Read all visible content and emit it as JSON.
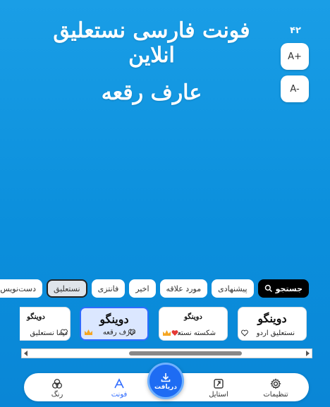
{
  "preview": {
    "line1": "فونت فارسی نستعلیق انلاین",
    "line2": "عارف رقعه"
  },
  "size_control": {
    "value": "۴۲",
    "increase_label": "A+",
    "decrease_label": "A-"
  },
  "categories": [
    {
      "label": "جستجو",
      "type": "search",
      "icon": "search-icon"
    },
    {
      "label": "پیشنهادی"
    },
    {
      "label": "مورد علاقه"
    },
    {
      "label": "اخیر"
    },
    {
      "label": "فانتزی"
    },
    {
      "label": "نستعلیق",
      "selected": true
    },
    {
      "label": "دست‌نویس"
    }
  ],
  "fonts": [
    {
      "sample": "دوینگو",
      "label": "نستعلیق اردو",
      "favorite": false,
      "premium": false
    },
    {
      "sample": "دوینگو",
      "label": "شکسته نستعلیق",
      "favorite": true,
      "premium": true
    },
    {
      "sample": "دوینگو",
      "label": "عارف رقعه",
      "favorite": false,
      "premium": true,
      "selected": true
    },
    {
      "sample": "دوینگو",
      "label": "دیما نستعلیق",
      "favorite": false,
      "premium": false
    }
  ],
  "nav": {
    "settings": "تنظیمات",
    "style": "استایل",
    "download": "دریافت",
    "font": "فونت",
    "color": "رنگ"
  },
  "colors": {
    "background": "#0b8fdc",
    "accent": "#2f6bff",
    "heart": "#e53935",
    "crown": "#f5a623"
  }
}
